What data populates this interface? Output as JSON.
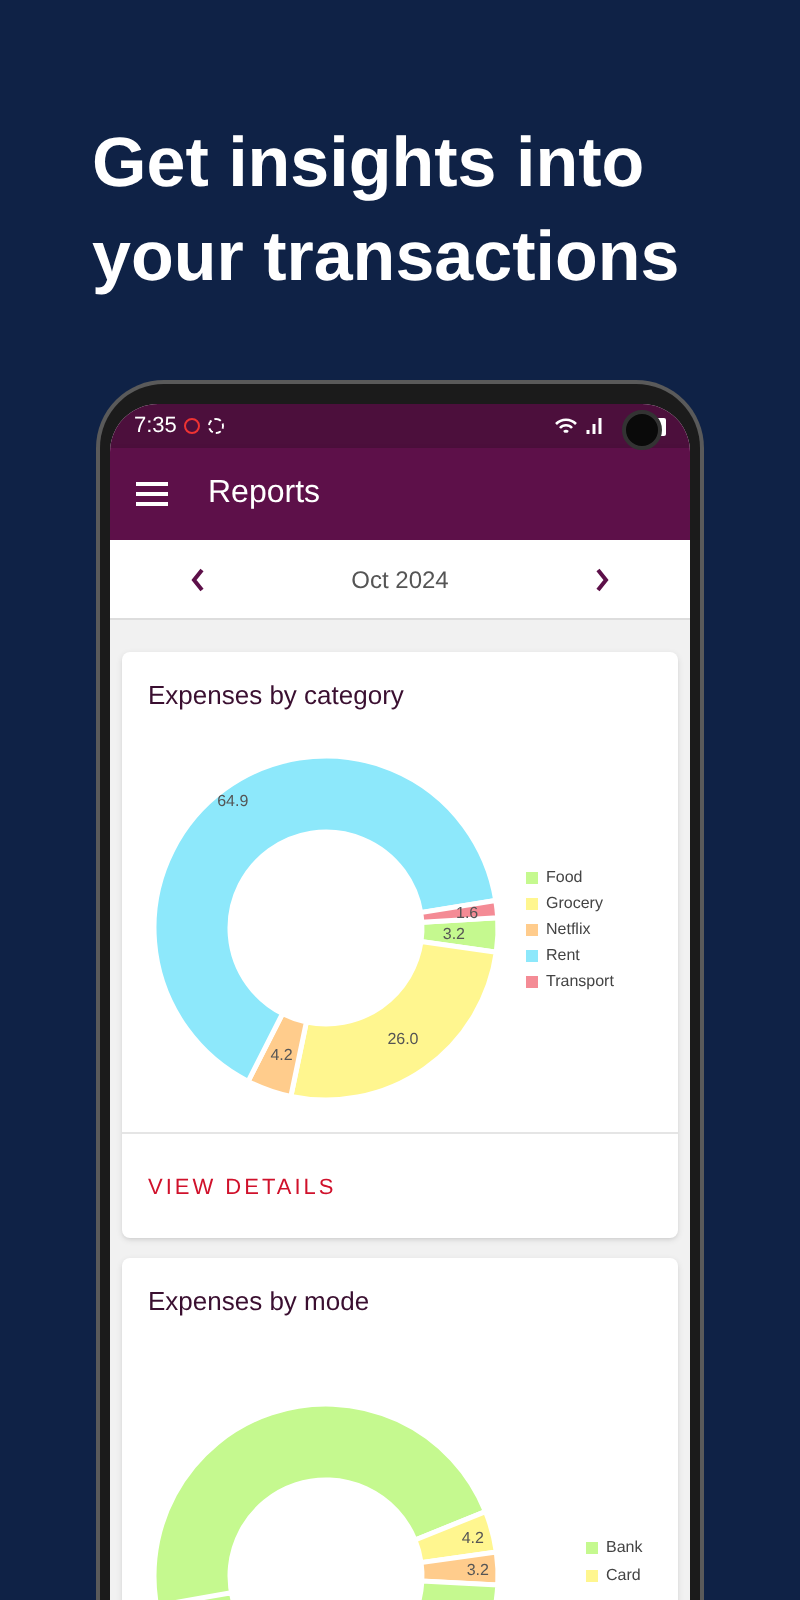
{
  "headline": "Get insights into your transactions",
  "status_bar": {
    "time": "7:35"
  },
  "app_bar": {
    "title": "Reports"
  },
  "period": {
    "label": "Oct 2024"
  },
  "cards": [
    {
      "title": "Expenses by category",
      "chart_data": {
        "type": "donut",
        "categories": [
          "Food",
          "Grocery",
          "Netflix",
          "Rent",
          "Transport"
        ],
        "values": [
          3.2,
          26.0,
          4.2,
          64.9,
          1.6
        ],
        "colors": [
          "#c5f98f",
          "#fff68f",
          "#ffcc8c",
          "#8de8fb",
          "#f48b95"
        ],
        "value_labels": [
          "3.2",
          "26.0",
          "4.2",
          "64.9",
          "1.6"
        ]
      },
      "action": "VIEW DETAILS"
    },
    {
      "title": "Expenses by mode",
      "slice_labels": [
        "4.2",
        "3.2"
      ],
      "legend": [
        {
          "label": "Bank",
          "color": "#c5f98f"
        },
        {
          "label": "Card",
          "color": "#fff68f"
        }
      ]
    }
  ]
}
